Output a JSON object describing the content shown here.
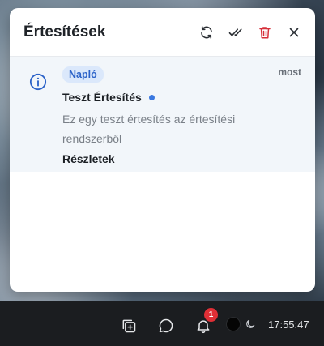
{
  "panel": {
    "title": "Értesítések",
    "actions": [
      {
        "name": "refresh-icon"
      },
      {
        "name": "mark-all-read-icon"
      },
      {
        "name": "trash-icon",
        "color": "#d6303a"
      },
      {
        "name": "close-icon"
      }
    ]
  },
  "notification": {
    "icon": "info-icon",
    "category": "Napló",
    "time": "most",
    "title": "Teszt Értesítés",
    "unread": true,
    "body": "Ez egy teszt értesítés az értesítési rendszerből",
    "action_label": "Részletek"
  },
  "taskbar": {
    "icons": [
      "add-window-icon",
      "chat-icon",
      "bell-icon"
    ],
    "bell_count": "1",
    "clock": "17:55:47"
  },
  "colors": {
    "accent": "#2b62c8",
    "badge_bg": "#dbe8fb",
    "danger": "#d6303a",
    "unread_dot": "#3a78e0"
  }
}
